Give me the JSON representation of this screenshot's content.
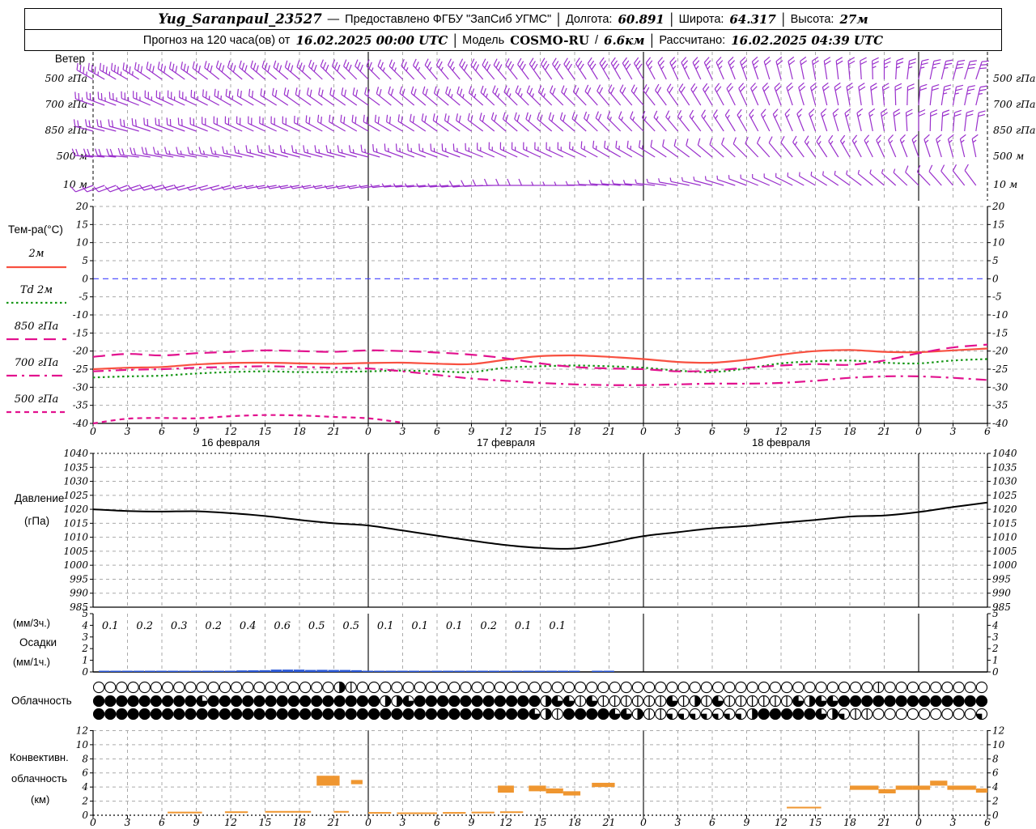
{
  "header": {
    "line1": [
      {
        "t": "Yug_Saranpaul_23527",
        "s": "station"
      },
      {
        "t": "—",
        "s": "plain"
      },
      {
        "t": "Предоставлено ФГБУ \"ЗапСиб УГМС\"",
        "s": "plain"
      },
      {
        "t": "|",
        "s": "sep"
      },
      {
        "t": "Долгота:",
        "s": "plain"
      },
      {
        "t": "60.891",
        "s": "num"
      },
      {
        "t": "|",
        "s": "sep"
      },
      {
        "t": "Широта:",
        "s": "plain"
      },
      {
        "t": "64.317",
        "s": "num"
      },
      {
        "t": "|",
        "s": "sep"
      },
      {
        "t": "Высота:",
        "s": "plain"
      },
      {
        "t": "27м",
        "s": "num"
      }
    ],
    "line2": [
      {
        "t": "Прогноз на 120 часа(ов) от",
        "s": "plain"
      },
      {
        "t": "16.02.2025 00:00 UTC",
        "s": "num"
      },
      {
        "t": "|",
        "s": "sep"
      },
      {
        "t": "Модель",
        "s": "plain"
      },
      {
        "t": "COSMO-RU",
        "s": "model"
      },
      {
        "t": "/",
        "s": "plain"
      },
      {
        "t": "6.6км",
        "s": "num"
      },
      {
        "t": "|",
        "s": "sep"
      },
      {
        "t": "Рассчитано:",
        "s": "plain"
      },
      {
        "t": "16.02.2025 04:39 UTC",
        "s": "num"
      }
    ]
  },
  "colors": {
    "wind": "#9a30cc",
    "t2m": "#f85040",
    "td2m": "#169616",
    "pink": "#e2118e",
    "pressure": "#000000",
    "precip_bar": "#2b59d8",
    "convective": "#ef9630",
    "grid": "#aaaaaa",
    "zero_line": "#4040ff",
    "axis": "#000000"
  },
  "time_axis": {
    "start_hour": 0,
    "end_hour": 78,
    "tick_step": 3,
    "day_boundaries": [
      24,
      48,
      72
    ],
    "date_labels": [
      {
        "text": "16 февраля",
        "hour": 12
      },
      {
        "text": "17 февраля",
        "hour": 36
      },
      {
        "text": "18 февраля",
        "hour": 60
      }
    ]
  },
  "wind": {
    "title": "Ветер",
    "levels": [
      {
        "label": "500 гПа",
        "dirs": [
          300,
          300,
          305,
          305,
          310,
          310,
          310,
          315,
          315,
          315,
          320,
          320,
          320,
          325,
          325,
          330,
          330,
          335,
          335,
          340,
          345,
          350,
          355,
          360,
          370,
          375,
          380
        ],
        "spds": [
          18,
          18,
          17,
          17,
          16,
          16,
          15,
          15,
          15,
          14,
          14,
          15,
          15,
          16,
          16,
          15,
          15,
          14,
          13,
          13,
          12,
          12,
          12,
          13,
          14,
          15,
          15
        ]
      },
      {
        "label": "700 гПа",
        "dirs": [
          290,
          290,
          295,
          295,
          300,
          300,
          305,
          305,
          305,
          310,
          310,
          310,
          315,
          315,
          315,
          320,
          320,
          325,
          330,
          335,
          340,
          345,
          350,
          355,
          365,
          370,
          375
        ],
        "spds": [
          14,
          14,
          13,
          13,
          13,
          12,
          12,
          12,
          12,
          12,
          12,
          13,
          13,
          13,
          12,
          12,
          11,
          11,
          10,
          10,
          10,
          10,
          11,
          12,
          12,
          13,
          13
        ]
      },
      {
        "label": "850 гПа",
        "dirs": [
          285,
          285,
          290,
          290,
          295,
          295,
          295,
          300,
          300,
          300,
          305,
          305,
          310,
          310,
          310,
          315,
          315,
          320,
          325,
          330,
          335,
          340,
          345,
          350,
          360,
          365,
          370
        ],
        "spds": [
          12,
          12,
          11,
          11,
          11,
          10,
          10,
          10,
          10,
          10,
          10,
          11,
          11,
          11,
          10,
          10,
          9,
          9,
          9,
          8,
          8,
          9,
          9,
          10,
          10,
          11,
          11
        ]
      },
      {
        "label": "500 м",
        "dirs": [
          275,
          275,
          280,
          280,
          280,
          285,
          285,
          285,
          285,
          290,
          290,
          290,
          295,
          295,
          295,
          300,
          300,
          305,
          310,
          315,
          320,
          325,
          330,
          335,
          340,
          345,
          350
        ],
        "spds": [
          10,
          10,
          10,
          9,
          9,
          9,
          9,
          8,
          8,
          8,
          8,
          9,
          9,
          9,
          8,
          8,
          8,
          7,
          7,
          7,
          7,
          8,
          8,
          8,
          9,
          9,
          9
        ]
      },
      {
        "label": "10 м",
        "dirs": [
          250,
          250,
          255,
          255,
          255,
          260,
          260,
          260,
          260,
          265,
          265,
          265,
          270,
          270,
          270,
          275,
          275,
          280,
          285,
          290,
          295,
          300,
          305,
          310,
          315,
          320,
          325
        ],
        "spds": [
          5,
          5,
          5,
          5,
          4,
          4,
          4,
          4,
          4,
          4,
          4,
          5,
          5,
          5,
          4,
          4,
          4,
          3,
          3,
          3,
          3,
          4,
          4,
          4,
          5,
          5,
          5
        ]
      }
    ]
  },
  "chart_data": [
    {
      "type": "line",
      "name": "temperature",
      "title": "Тем-ра(°C)",
      "ylim": [
        -40,
        20
      ],
      "ytick": 5,
      "x_step_hours": 3,
      "series": [
        {
          "name": "2м",
          "color_key": "t2m",
          "style": "solid",
          "values": [
            -25.0,
            -24.6,
            -24.4,
            -23.7,
            -23.3,
            -23.2,
            -23.4,
            -23.5,
            -23.3,
            -23.2,
            -23.5,
            -23.6,
            -22.4,
            -21.4,
            -21.2,
            -21.6,
            -22.2,
            -23.0,
            -23.2,
            -22.4,
            -21.0,
            -20.0,
            -19.7,
            -20.2,
            -20.3,
            -19.8,
            -19.3
          ]
        },
        {
          "name": "Td 2м",
          "color_key": "td2m",
          "style": "dotted",
          "values": [
            -27.3,
            -27.0,
            -26.8,
            -26.2,
            -25.8,
            -25.6,
            -25.8,
            -25.8,
            -25.6,
            -25.4,
            -25.6,
            -25.8,
            -24.6,
            -24.2,
            -24.0,
            -24.2,
            -24.6,
            -25.4,
            -25.8,
            -24.8,
            -23.4,
            -22.8,
            -22.6,
            -23.2,
            -23.4,
            -22.6,
            -22.2
          ]
        },
        {
          "name": "850 гПа",
          "color_key": "pink",
          "style": "longdash",
          "values": [
            -21.6,
            -20.8,
            -21.2,
            -20.6,
            -20.2,
            -19.8,
            -20.0,
            -20.2,
            -19.8,
            -20.0,
            -20.4,
            -21.0,
            -22.0,
            -23.4,
            -24.4,
            -24.8,
            -25.0,
            -25.6,
            -25.4,
            -24.6,
            -24.0,
            -23.6,
            -23.8,
            -22.6,
            -20.6,
            -19.0,
            -18.2
          ]
        },
        {
          "name": "700 гПа",
          "color_key": "pink",
          "style": "dashdot",
          "values": [
            -25.6,
            -25.2,
            -25.0,
            -24.6,
            -24.4,
            -24.2,
            -24.4,
            -24.6,
            -24.8,
            -25.6,
            -26.6,
            -27.6,
            -28.2,
            -28.8,
            -29.2,
            -29.4,
            -29.4,
            -29.2,
            -29.0,
            -29.0,
            -28.8,
            -28.2,
            -27.4,
            -27.0,
            -27.0,
            -27.4,
            -28.0
          ]
        },
        {
          "name": "500 гПа",
          "color_key": "pink",
          "style": "shortdash",
          "values": [
            -40.0,
            -38.7,
            -38.5,
            -38.6,
            -38.0,
            -37.7,
            -37.8,
            -38.2,
            -38.6,
            -39.8,
            null,
            null,
            null,
            null,
            null,
            null,
            null,
            null,
            null,
            null,
            null,
            null,
            null,
            null,
            null,
            null,
            null
          ]
        }
      ],
      "zero_line": 0
    },
    {
      "type": "line",
      "name": "pressure",
      "ylabel_1": "Давление",
      "ylabel_2": "(гПа)",
      "ylim": [
        985,
        1040
      ],
      "ytick": 5,
      "x_step_hours": 3,
      "values": [
        1020.0,
        1019.4,
        1019.2,
        1019.3,
        1018.6,
        1017.6,
        1016.2,
        1015.0,
        1014.2,
        1012.4,
        1010.6,
        1008.8,
        1007.2,
        1006.2,
        1006.0,
        1008.0,
        1010.4,
        1011.8,
        1013.2,
        1014.0,
        1015.2,
        1016.2,
        1017.4,
        1017.8,
        1019.0,
        1020.8,
        1022.4
      ]
    },
    {
      "type": "bar",
      "name": "precipitation",
      "label_top": "(мм/3ч.)",
      "label_mid": "Осадки",
      "label_bot": "(мм/1ч.)",
      "ylim": [
        0,
        5
      ],
      "ytick": 1,
      "amounts_3h": [
        "0.1",
        "0.2",
        "0.3",
        "0.2",
        "0.4",
        "0.6",
        "0.5",
        "0.5",
        "0.1",
        "0.1",
        "0.1",
        "0.2",
        "0.1",
        "0.1"
      ],
      "hourly": [
        0,
        0.04,
        0.04,
        0.05,
        0.07,
        0.07,
        0.08,
        0.1,
        0.1,
        0.1,
        0.07,
        0.07,
        0.08,
        0.13,
        0.14,
        0.15,
        0.2,
        0.2,
        0.2,
        0.17,
        0.18,
        0.17,
        0.17,
        0.15,
        0.05,
        0.04,
        0.04,
        0.04,
        0.04,
        0.04,
        0.04,
        0.04,
        0.04,
        0.06,
        0.07,
        0.06,
        0.04,
        0.04,
        0.04,
        0.04,
        0.04,
        0.03,
        0.03,
        0,
        0.05,
        0.05,
        0,
        0,
        0,
        0,
        0,
        0,
        0,
        0,
        0,
        0,
        0,
        0,
        0,
        0,
        0,
        0,
        0,
        0,
        0,
        0,
        0,
        0,
        0,
        0,
        0,
        0,
        0,
        0,
        0,
        0,
        0,
        0,
        0
      ]
    },
    {
      "type": "blocks",
      "name": "convective-cloudiness",
      "label_1": "Конвективн.",
      "label_2": "облачность",
      "label_3": "(км)",
      "ylim": [
        0,
        12
      ],
      "ytick": 2,
      "blocks": [
        {
          "h0": 6.5,
          "h1": 9.5,
          "b": 0.3,
          "t": 0.5
        },
        {
          "h0": 11.5,
          "h1": 13.5,
          "b": 0.35,
          "t": 0.55
        },
        {
          "h0": 15,
          "h1": 19,
          "b": 0.4,
          "t": 0.6
        },
        {
          "h0": 19.5,
          "h1": 21.5,
          "b": 4.2,
          "t": 5.6
        },
        {
          "h0": 21,
          "h1": 22.3,
          "b": 0.4,
          "t": 0.6
        },
        {
          "h0": 22.5,
          "h1": 23.5,
          "b": 4.4,
          "t": 5.0
        },
        {
          "h0": 24,
          "h1": 26,
          "b": 0.25,
          "t": 0.45
        },
        {
          "h0": 26.5,
          "h1": 30,
          "b": 0.2,
          "t": 0.4
        },
        {
          "h0": 30.5,
          "h1": 32.5,
          "b": 0.25,
          "t": 0.45
        },
        {
          "h0": 33,
          "h1": 35,
          "b": 0.3,
          "t": 0.5
        },
        {
          "h0": 35.5,
          "h1": 37.5,
          "b": 0.35,
          "t": 0.55
        },
        {
          "h0": 35.3,
          "h1": 36.7,
          "b": 3.2,
          "t": 4.2
        },
        {
          "h0": 38,
          "h1": 39.5,
          "b": 3.4,
          "t": 4.2
        },
        {
          "h0": 39.5,
          "h1": 41,
          "b": 3.1,
          "t": 3.8
        },
        {
          "h0": 41,
          "h1": 42.5,
          "b": 2.8,
          "t": 3.4
        },
        {
          "h0": 43.5,
          "h1": 45.5,
          "b": 4.0,
          "t": 4.6
        },
        {
          "h0": 60.5,
          "h1": 63.5,
          "b": 1.0,
          "t": 1.2
        },
        {
          "h0": 66,
          "h1": 68.5,
          "b": 3.6,
          "t": 4.2
        },
        {
          "h0": 68.5,
          "h1": 70,
          "b": 3.1,
          "t": 3.7
        },
        {
          "h0": 70,
          "h1": 71.5,
          "b": 3.6,
          "t": 4.2
        },
        {
          "h0": 71.5,
          "h1": 73,
          "b": 3.6,
          "t": 4.2
        },
        {
          "h0": 73,
          "h1": 74.5,
          "b": 4.2,
          "t": 4.9
        },
        {
          "h0": 74.5,
          "h1": 77,
          "b": 3.6,
          "t": 4.2
        },
        {
          "h0": 77,
          "h1": 78,
          "b": 3.2,
          "t": 3.8
        }
      ]
    }
  ],
  "cloudiness": {
    "label": "Облачность",
    "okta_codes": "0=clear,1=1okta,2=quarter,4=half,6=threequarter,8=overcast",
    "rows": [
      "000000000000000000000410000000000000000000000000000000000000000000001000000000",
      "888888888688888888888888844688888888888466161111116141611111164668888888888888",
      "888888888888888888888888888888888888886418888664112222222488888642110000000002"
    ]
  }
}
